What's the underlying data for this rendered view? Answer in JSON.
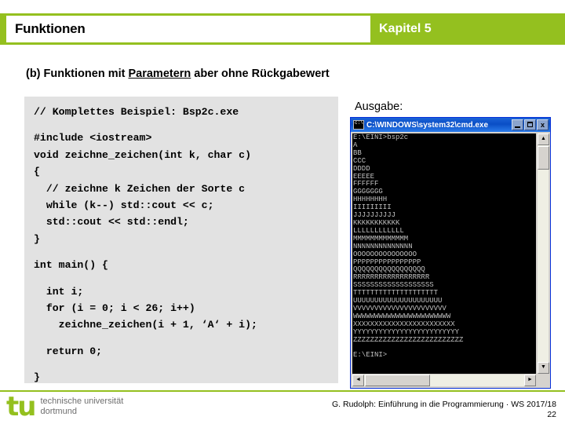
{
  "header": {
    "title": "Funktionen",
    "chapter": "Kapitel 5",
    "bar_color": "#94c01f",
    "title_color": "#000000",
    "chapter_color": "#ffffff"
  },
  "subtitle": {
    "prefix": "(b) Funktionen mit ",
    "underlined": "Parametern",
    "suffix": " aber ohne Rückgabewert"
  },
  "code_block": {
    "background": "#e2e2e2",
    "lines": [
      "// Komplettes Beispiel: Bsp2c.exe",
      "",
      "#include <iostream>",
      "void zeichne_zeichen(int k, char c)",
      "{",
      "  // zeichne k Zeichen der Sorte c",
      "  while (k--) std::cout << c;",
      "  std::cout << std::endl;",
      "}",
      "",
      "int main() {",
      "",
      "  int i;",
      "  for (i = 0; i < 26; i++)",
      "    zeichne_zeichen(i + 1, ‘A‘ + i);",
      "",
      "  return 0;",
      "",
      "}"
    ]
  },
  "output": {
    "label": "Ausgabe:",
    "window": {
      "title": "C:\\WINDOWS\\system32\\cmd.exe",
      "icon": "console-icon",
      "minimize_label": "",
      "maximize_label": "",
      "close_label": "x",
      "titlebar_color": "#0a4ec6",
      "screen_bg": "#000000",
      "screen_fg": "#c0c0c0",
      "scroll_up_glyph": "▲",
      "scroll_down_glyph": "▼",
      "scroll_left_glyph": "◄",
      "scroll_right_glyph": "►"
    },
    "console_lines": [
      "E:\\EINI>bsp2c",
      "A",
      "BB",
      "CCC",
      "DDDD",
      "EEEEE",
      "FFFFFF",
      "GGGGGGG",
      "HHHHHHHH",
      "IIIIIIIII",
      "JJJJJJJJJJ",
      "KKKKKKKKKKK",
      "LLLLLLLLLLLL",
      "MMMMMMMMMMMMM",
      "NNNNNNNNNNNNNN",
      "OOOOOOOOOOOOOOO",
      "PPPPPPPPPPPPPPPP",
      "QQQQQQQQQQQQQQQQQ",
      "RRRRRRRRRRRRRRRRRR",
      "SSSSSSSSSSSSSSSSSSS",
      "TTTTTTTTTTTTTTTTTTTT",
      "UUUUUUUUUUUUUUUUUUUUU",
      "VVVVVVVVVVVVVVVVVVVVVV",
      "WWWWWWWWWWWWWWWWWWWWWWW",
      "XXXXXXXXXXXXXXXXXXXXXXXX",
      "YYYYYYYYYYYYYYYYYYYYYYYYY",
      "ZZZZZZZZZZZZZZZZZZZZZZZZZZ",
      "",
      "E:\\EINI>"
    ]
  },
  "footer": {
    "logo_mark": "tu",
    "logo_line1": "technische universität",
    "logo_line2": "dortmund",
    "credit": "G. Rudolph: Einführung in die Programmierung · WS 2017/18",
    "page_number": "22",
    "accent_color": "#94c01f"
  }
}
